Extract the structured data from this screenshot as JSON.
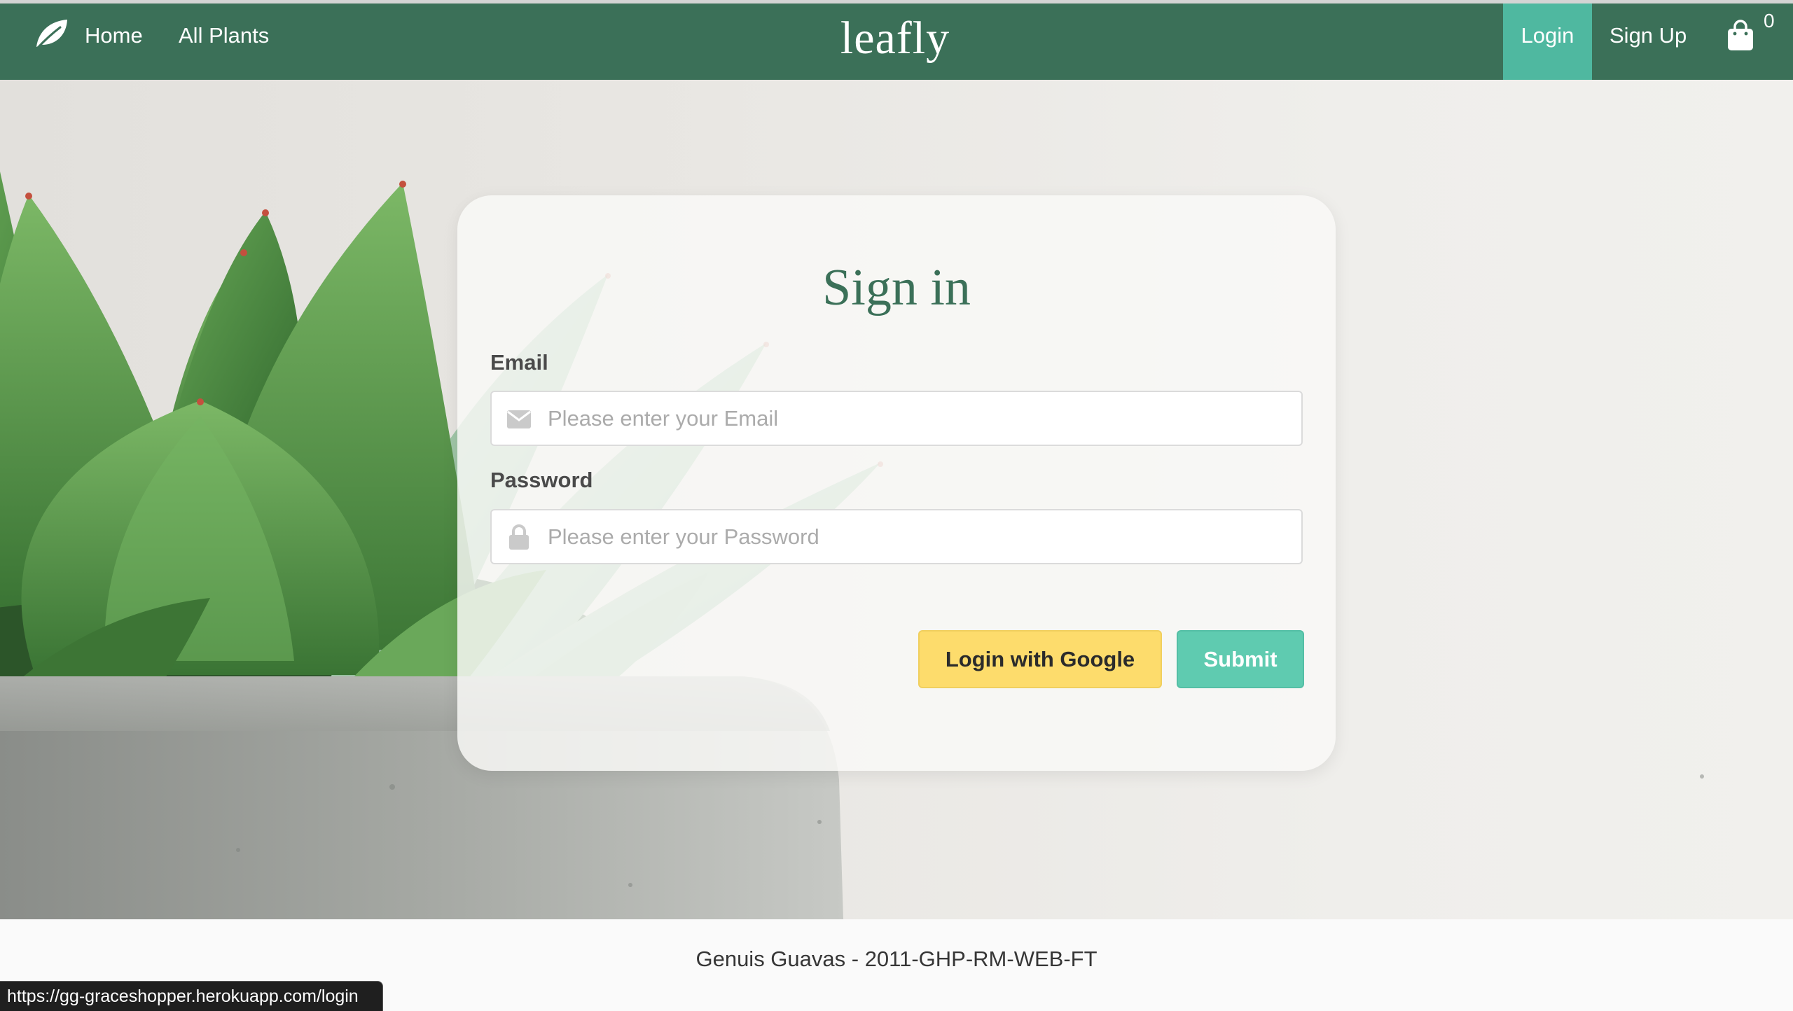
{
  "nav": {
    "brand": "leafly",
    "links": [
      "Home",
      "All Plants"
    ],
    "login": "Login",
    "signup": "Sign Up",
    "cart_count": "0"
  },
  "card": {
    "title": "Sign in",
    "email_label": "Email",
    "email_placeholder": "Please enter your Email",
    "password_label": "Password",
    "password_placeholder": "Please enter your Password",
    "google_button": "Login with Google",
    "submit_button": "Submit"
  },
  "footer": {
    "text": "Genuis Guavas - 2011-GHP-RM-WEB-FT"
  },
  "status_bar": {
    "url": "https://gg-graceshopper.herokuapp.com/login"
  },
  "icons": {
    "brand": "leaf-icon",
    "cart": "shopping-bag-icon",
    "email": "envelope-icon",
    "password": "lock-icon"
  },
  "colors": {
    "navbar": "#3b7058",
    "active_nav": "#4fb8a0",
    "title": "#3b7058",
    "google_button": "#fddc6c",
    "submit_button": "#5fcbb0"
  }
}
